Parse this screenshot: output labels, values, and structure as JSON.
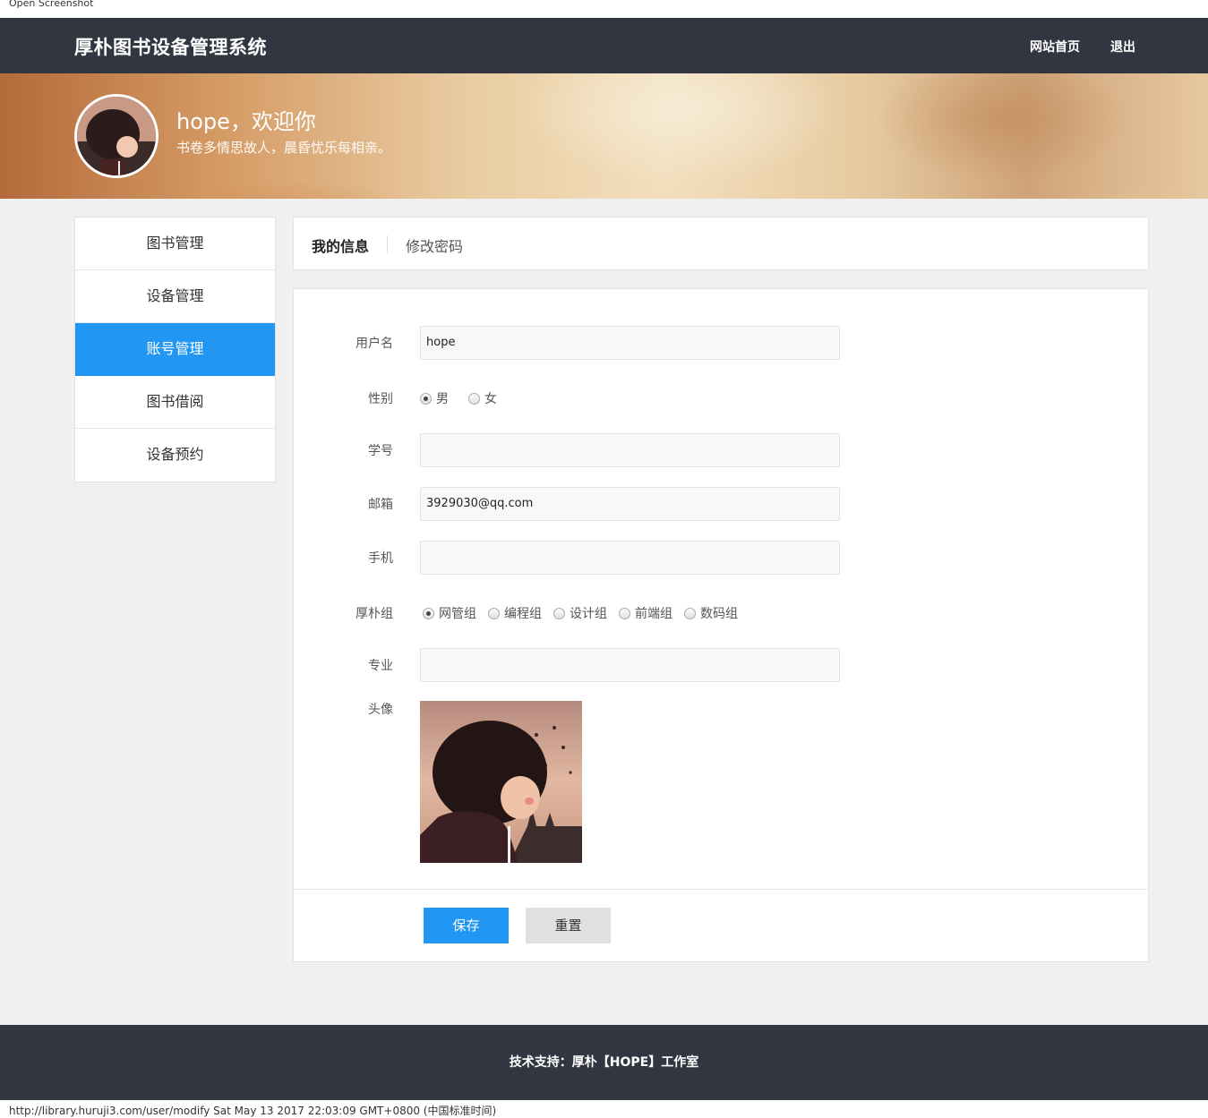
{
  "print": {
    "header": "Open Screenshot",
    "footer": "http://library.huruji3.com/user/modify Sat May 13 2017 22:03:09 GMT+0800 (中国标准时间)"
  },
  "header": {
    "brand": "厚朴图书设备管理系统",
    "nav": [
      "网站首页",
      "退出"
    ]
  },
  "banner": {
    "welcome": "hope，欢迎你",
    "motto": "书卷多情思故人，晨昏忧乐每相亲。"
  },
  "sidebar": {
    "items": [
      "图书管理",
      "设备管理",
      "账号管理",
      "图书借阅",
      "设备预约"
    ],
    "active": "账号管理"
  },
  "tabs": [
    "我的信息",
    "修改密码"
  ],
  "form": {
    "username": {
      "label": "用户名",
      "value": "hope"
    },
    "gender": {
      "label": "性别",
      "options": [
        "男",
        "女"
      ],
      "selected": "男"
    },
    "student_id": {
      "label": "学号",
      "value": ""
    },
    "email": {
      "label": "邮箱",
      "value": "3929030@qq.com"
    },
    "phone": {
      "label": "手机",
      "value": ""
    },
    "group": {
      "label": "厚朴组",
      "options": [
        "网管组",
        "编程组",
        "设计组",
        "前端组",
        "数码组"
      ],
      "selected": "网管组"
    },
    "major": {
      "label": "专业",
      "value": ""
    },
    "avatar": {
      "label": "头像"
    },
    "save_label": "保存",
    "reset_label": "重置"
  },
  "footer": {
    "text": "技术支持：厚朴【HOPE】工作室"
  },
  "colors": {
    "topbar": "#323640",
    "accent": "#2196f3",
    "page_bg": "#f0f0f0"
  }
}
